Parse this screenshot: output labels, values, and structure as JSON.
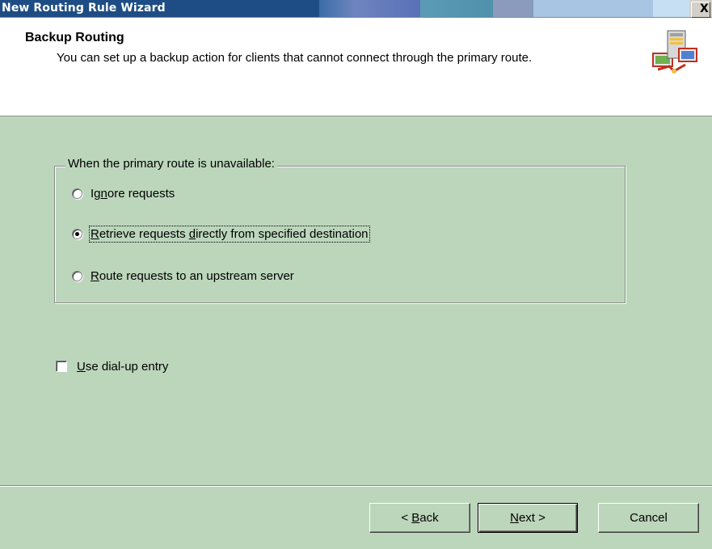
{
  "window": {
    "title": "New Routing Rule Wizard",
    "close_label": "X"
  },
  "header": {
    "title": "Backup Routing",
    "subtitle": "You can set up a backup action for clients that cannot connect through the primary route.",
    "icon": "server-routing-icon"
  },
  "group": {
    "legend": "When the primary route is unavailable:",
    "options": [
      {
        "pre": "Ig",
        "ul": "n",
        "post": "ore requests",
        "checked": false
      },
      {
        "pre": "",
        "ul": "R",
        "post": "etrieve requests ",
        "ul2": "d",
        "post2": "irectly from specified destination",
        "checked": true
      },
      {
        "pre": "",
        "ul": "R",
        "post": "oute requests to an upstream server",
        "checked": false
      }
    ]
  },
  "dialup": {
    "ul": "U",
    "label_rest": "se dial-up entry",
    "checked": false
  },
  "buttons": {
    "back_pre": "< ",
    "back_ul": "B",
    "back_post": "ack",
    "next_ul": "N",
    "next_post": "ext >",
    "cancel": "Cancel"
  },
  "colors": {
    "background": "#bcd6bc",
    "titlebar": "#1d4d84",
    "header": "#ffffff"
  }
}
